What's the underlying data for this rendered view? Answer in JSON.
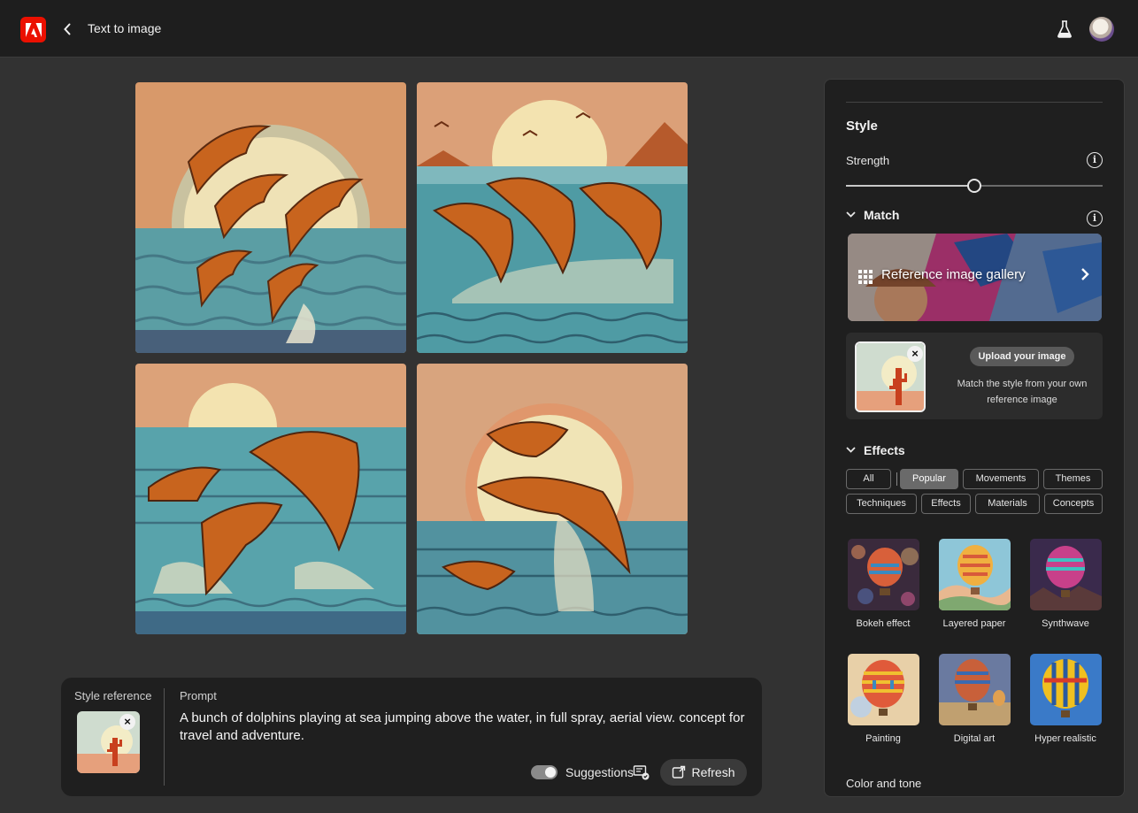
{
  "header": {
    "title": "Text to image",
    "icons": {
      "logo": "adobe-logo-icon",
      "back": "chevron-left-icon",
      "labs": "flask-icon",
      "profile": "avatar"
    },
    "accent_color": "#eb1000"
  },
  "results": {
    "images": [
      {
        "name": "generated-image-1",
        "icon": "dolphins-image"
      },
      {
        "name": "generated-image-2",
        "icon": "dolphins-image"
      },
      {
        "name": "generated-image-3",
        "icon": "dolphins-image"
      },
      {
        "name": "generated-image-4",
        "icon": "dolphins-image"
      }
    ]
  },
  "prompt_panel": {
    "style_reference_label": "Style reference",
    "prompt_label": "Prompt",
    "prompt_text": "A bunch of dolphins playing at sea jumping above the water, in full spray, aerial view. concept for travel and adventure.",
    "suggestions_label": "Suggestions",
    "suggestions_on": true,
    "refresh_label": "Refresh"
  },
  "style_panel": {
    "title": "Style",
    "strength_label": "Strength",
    "strength_value": 0.5,
    "match": {
      "label": "Match",
      "gallery_label": "Reference image gallery",
      "upload_button": "Upload your image",
      "upload_description": "Match the style from your own reference image"
    },
    "effects": {
      "label": "Effects",
      "filters": [
        "All",
        "Popular",
        "Movements",
        "Themes",
        "Techniques",
        "Effects",
        "Materials",
        "Concepts"
      ],
      "active_filter": "Popular",
      "items": [
        {
          "label": "Bokeh effect"
        },
        {
          "label": "Layered paper"
        },
        {
          "label": "Synthwave"
        },
        {
          "label": "Painting"
        },
        {
          "label": "Digital art"
        },
        {
          "label": "Hyper realistic"
        }
      ]
    },
    "color_tone_label": "Color and tone"
  }
}
